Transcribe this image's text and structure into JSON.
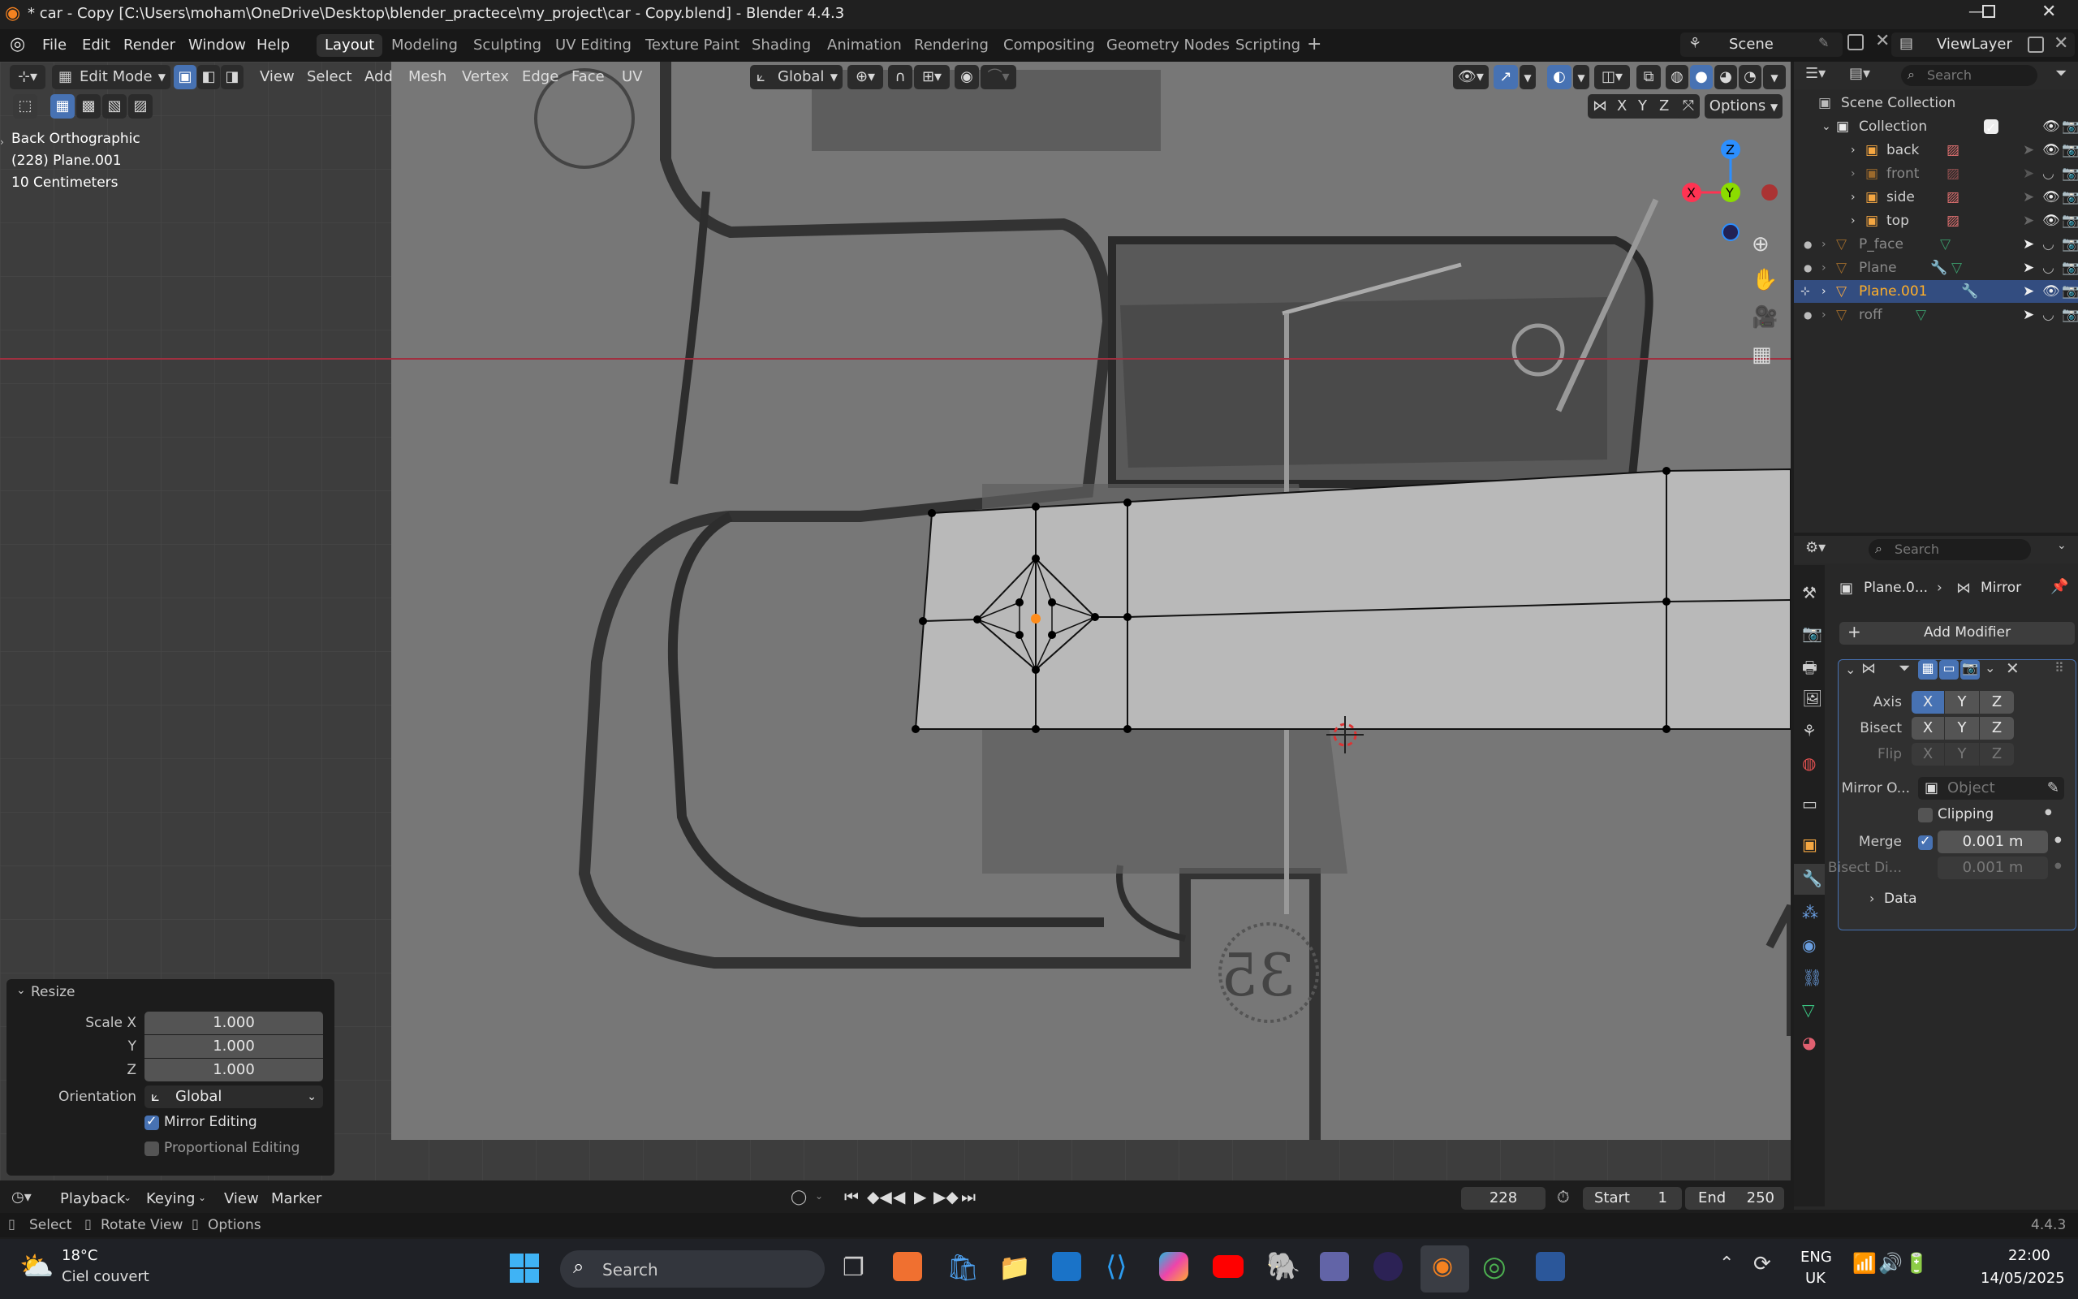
{
  "window": {
    "title": "* car - Copy [C:\\Users\\moham\\OneDrive\\Desktop\\blender_practece\\my_project\\car - Copy.blend] - Blender 4.4.3",
    "controls": [
      "—",
      "❐",
      "✕"
    ]
  },
  "menu": [
    "File",
    "Edit",
    "Render",
    "Window",
    "Help"
  ],
  "workspaces": [
    "Layout",
    "Modeling",
    "Sculpting",
    "UV Editing",
    "Texture Paint",
    "Shading",
    "Animation",
    "Rendering",
    "Compositing",
    "Geometry Nodes",
    "Scripting"
  ],
  "scene": {
    "name": "Scene",
    "view_layer": "ViewLayer"
  },
  "viewport_header": {
    "mode": "Edit Mode",
    "menus": [
      "View",
      "Select",
      "Add",
      "Mesh",
      "Vertex",
      "Edge",
      "Face",
      "UV"
    ],
    "orientation": "Global",
    "options_label": "Options",
    "axes": [
      "X",
      "Y",
      "Z"
    ]
  },
  "overlay_text": {
    "view": "Back Orthographic",
    "object": "(228) Plane.001",
    "scale": "10 Centimeters"
  },
  "gizmo": {
    "z": "Z",
    "y": "Y",
    "x": "X"
  },
  "resize_panel": {
    "title": "Resize",
    "scale_x_label": "Scale X",
    "scale_x": "1.000",
    "y_label": "Y",
    "y": "1.000",
    "z_label": "Z",
    "z": "1.000",
    "orientation_label": "Orientation",
    "orientation": "Global",
    "mirror_editing": "Mirror Editing",
    "mirror_checked": true,
    "proportional_editing": "Proportional Editing",
    "proportional_checked": false
  },
  "outliner": {
    "search_placeholder": "Search",
    "root": "Scene Collection",
    "items": [
      {
        "name": "Collection",
        "level": 0
      },
      {
        "name": "back",
        "level": 1
      },
      {
        "name": "front",
        "level": 1
      },
      {
        "name": "side",
        "level": 1
      },
      {
        "name": "top",
        "level": 1
      },
      {
        "name": "P_face",
        "level": 0
      },
      {
        "name": "Plane",
        "level": 0
      },
      {
        "name": "Plane.001",
        "level": 0,
        "selected": true
      },
      {
        "name": "roff",
        "level": 0
      }
    ]
  },
  "properties": {
    "search_placeholder": "Search",
    "breadcrumb_object": "Plane.0...",
    "breadcrumb_modifier": "Mirror",
    "add_modifier": "Add Modifier",
    "axis_label": "Axis",
    "bisect_label": "Bisect",
    "flip_label": "Flip",
    "axis_buttons": [
      "X",
      "Y",
      "Z"
    ],
    "mirror_object_label": "Mirror O...",
    "mirror_object_placeholder": "Object",
    "clipping": "Clipping",
    "merge_label": "Merge",
    "merge_value": "0.001 m",
    "bisect_distance_label": "Bisect Di...",
    "bisect_distance_value": "0.001 m",
    "data_label": "Data"
  },
  "timeline": {
    "menus": [
      "Playback",
      "Keying",
      "View",
      "Marker"
    ],
    "current_frame": "228",
    "start_label": "Start",
    "start": "1",
    "end_label": "End",
    "end": "250"
  },
  "statusbar": {
    "items": [
      "Select",
      "Rotate View",
      "Options"
    ],
    "version": "4.4.3"
  },
  "taskbar": {
    "weather_temp": "18°C",
    "weather_desc": "Ciel couvert",
    "search": "Search",
    "lang": "ENG",
    "region": "UK",
    "time": "22:00",
    "date": "14/05/2025"
  },
  "colors": {
    "accent": "#4772b3",
    "vertex_active": "#ff8c1a",
    "x_axis": "#ff3352",
    "y_axis": "#8bdc00",
    "z_axis": "#2c8fff"
  }
}
